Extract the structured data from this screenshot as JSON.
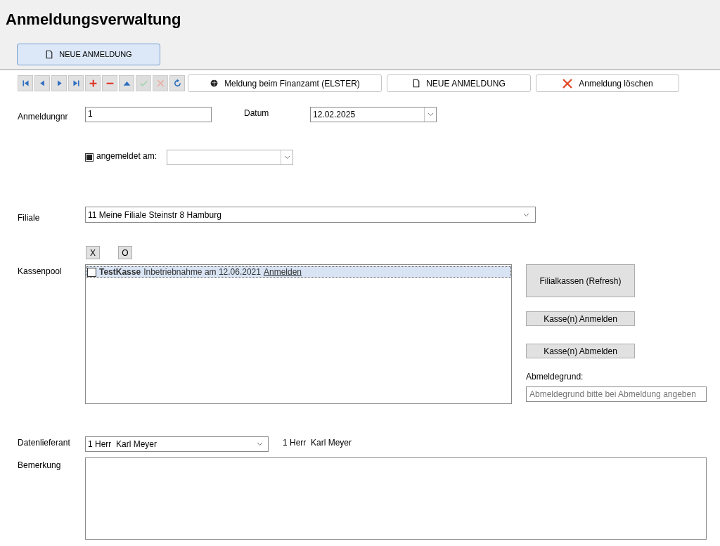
{
  "window": {
    "title": "Anmeldungsverwaltung"
  },
  "header_button": {
    "label": "NEUE ANMELDUNG"
  },
  "nav_buttons": [
    {
      "kind": "first",
      "disabled": false
    },
    {
      "kind": "prev",
      "disabled": false
    },
    {
      "kind": "next",
      "disabled": false
    },
    {
      "kind": "last",
      "disabled": false
    },
    {
      "kind": "add",
      "disabled": false
    },
    {
      "kind": "remove",
      "disabled": false
    },
    {
      "kind": "up",
      "disabled": false
    },
    {
      "kind": "confirm",
      "disabled": true
    },
    {
      "kind": "cancel",
      "disabled": true
    },
    {
      "kind": "refresh",
      "disabled": false
    }
  ],
  "toolbar_buttons": [
    {
      "kind": "elster",
      "label": "Meldung beim Finanzamt (ELSTER)"
    },
    {
      "kind": "new",
      "label": "NEUE ANMELDUNG"
    },
    {
      "kind": "delete",
      "label": "Anmeldung löschen"
    }
  ],
  "anmeldungnr": {
    "label": "Anmeldungnr",
    "value": "1"
  },
  "datum": {
    "label": "Datum",
    "value": "12.02.2025"
  },
  "angemeldet": {
    "label": "angemeldet am:",
    "checked": true
  },
  "filiale": {
    "label": "Filiale",
    "value": "11 Meine Filiale Steinstr 8 Hamburg"
  },
  "kassenpool": {
    "label": "Kassenpool",
    "select_buttons": [
      "X",
      "O"
    ],
    "items": [
      {
        "name": "TestKasse",
        "detail": "Inbetriebnahme am 12.06.2021",
        "link": "Anmelden",
        "checked": false,
        "selected": true
      }
    ]
  },
  "side_buttons": [
    "Filialkassen (Refresh)",
    "Kasse(n) Anmelden",
    "Kasse(n) Abmelden"
  ],
  "abmeldegrund": {
    "label": "Abmeldegrund:",
    "placeholder": "Abmeldegrund bitte bei Abmeldung angeben"
  },
  "datenlieferant": {
    "label": "Datenlieferant",
    "value": "1 Herr  Karl Meyer",
    "display": "1 Herr  Karl Meyer"
  },
  "bemerkung": {
    "label": "Bemerkung"
  }
}
